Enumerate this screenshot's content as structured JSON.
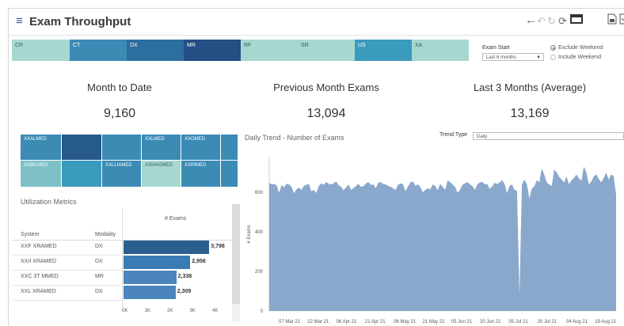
{
  "app": {
    "title": "Exam Throughput",
    "menu_icon": "hamburger-icon"
  },
  "toolbar": {
    "icons": [
      "back-arrow-icon",
      "undo-icon",
      "redo-icon",
      "refresh-icon",
      "present-icon",
      "export-image-icon",
      "export-pdf-icon"
    ]
  },
  "modality_strip": {
    "items": [
      {
        "label": "CR",
        "color": "#a7d8cf"
      },
      {
        "label": "CT",
        "color": "#3b8bb5"
      },
      {
        "label": "DX",
        "color": "#2c6e9e"
      },
      {
        "label": "MR",
        "color": "#244f84"
      },
      {
        "label": "RF",
        "color": "#a7d8cf"
      },
      {
        "label": "SR",
        "color": "#a7d8cf"
      },
      {
        "label": "US",
        "color": "#3b9bbf"
      },
      {
        "label": "XA",
        "color": "#a7d8cf"
      }
    ]
  },
  "filters": {
    "exam_start_label": "Exam Start",
    "exam_start_value": "Last 6 months",
    "weekend_options": [
      {
        "label": "Exclude Weekend",
        "selected": true
      },
      {
        "label": "Include Weekend",
        "selected": false
      }
    ]
  },
  "kpis": [
    {
      "title": "Month to Date",
      "value": "9,160"
    },
    {
      "title": "Previous Month Exams",
      "value": "13,094"
    },
    {
      "title": "Last 3 Months (Average)",
      "value": "13,169"
    }
  ],
  "site_tiles": [
    {
      "label": "XXALMED",
      "color": "#3b8bb5"
    },
    {
      "label": "",
      "color": "#265a8c"
    },
    {
      "label": "",
      "color": "#3b8bb5"
    },
    {
      "label": "XXLMED",
      "color": "#3b8bb5"
    },
    {
      "label": "XXOMED",
      "color": "#3b8bb5"
    },
    {
      "label": "",
      "color": "#3b8bb5"
    },
    {
      "label": "XXBILMED",
      "color": "#7fc0c6"
    },
    {
      "label": "",
      "color": "#3b9bbf"
    },
    {
      "label": "XXLLIAMED",
      "color": "#3b8bb5"
    },
    {
      "label": "XXMAGMED",
      "color": "#a7d8cf"
    },
    {
      "label": "XXRIMED",
      "color": "#3b8bb5"
    },
    {
      "label": "",
      "color": "#3b8bb5"
    }
  ],
  "utilization": {
    "title": "Utilization Metrics",
    "header_measure": "# Exams",
    "col_system": "System",
    "col_modality": "Modality",
    "rows": [
      {
        "system": "XXF XRAMED",
        "modality": "DX",
        "value": 3798,
        "label": "3,798",
        "color": "#2b5f90"
      },
      {
        "system": "XXrl XRAMED",
        "modality": "DX",
        "value": 2956,
        "label": "2,956",
        "color": "#3a7bb4"
      },
      {
        "system": "XXC 3T MMED",
        "modality": "MR",
        "value": 2338,
        "label": "2,338",
        "color": "#4a86bd"
      },
      {
        "system": "XXL XRAMED",
        "modality": "DX",
        "value": 2309,
        "label": "2,309",
        "color": "#4a86bd"
      }
    ],
    "axis_ticks": [
      "0K",
      "1K",
      "2K",
      "3K",
      "4K"
    ]
  },
  "trend": {
    "title": "Daily Trend - Number of Exams",
    "trend_type_label": "Trend Type",
    "trend_type_value": "Daily"
  },
  "chart_data": {
    "type": "area",
    "title": "Daily Trend - Number of Exams",
    "ylabel": "# Exams",
    "xlabel": "",
    "ylim": [
      0,
      780
    ],
    "yticks": [
      0,
      200,
      400,
      600
    ],
    "x_tick_labels": [
      "07 Mar 21",
      "22 Mar 21",
      "06 Apr 21",
      "21 Apr 21",
      "06 May 21",
      "21 May 21",
      "05 Jun 21",
      "20 Jun 21",
      "05 Jul 21",
      "20 Jul 21",
      "04 Aug 21",
      "19 Aug 21"
    ],
    "color": "#8aa8cc",
    "series": [
      {
        "values": [
          648,
          640,
          642,
          635,
          598,
          636,
          625,
          643,
          640,
          628,
          595,
          615,
          624,
          612,
          633,
          638,
          642,
          605,
          612,
          596,
          632,
          645,
          638,
          652,
          642,
          640,
          645,
          655,
          636,
          628,
          610,
          625,
          640,
          613,
          620,
          632,
          642,
          628,
          630,
          644,
          652,
          638,
          640,
          621,
          648,
          652,
          642,
          640,
          632,
          628,
          620,
          612,
          638,
          645,
          641,
          605,
          630,
          650,
          655,
          633,
          640,
          628,
          600,
          612,
          620,
          615,
          640,
          632,
          610,
          642,
          628,
          612,
          660,
          651,
          640,
          628,
          598,
          612,
          638,
          645,
          652,
          640,
          632,
          612,
          640,
          650,
          653,
          640,
          642,
          618,
          630,
          648,
          642,
          650,
          662,
          642,
          595,
          632,
          640,
          612,
          608,
          80,
          640,
          665,
          640,
          568,
          620,
          630,
          662,
          650,
          720,
          690,
          650,
          640,
          630,
          715,
          702,
          678,
          665,
          650,
          680,
          640,
          660,
          672,
          690,
          670,
          658,
          730,
          700,
          640,
          655,
          680,
          690,
          668,
          650,
          672,
          700,
          665,
          690,
          682,
          588
        ]
      }
    ]
  }
}
